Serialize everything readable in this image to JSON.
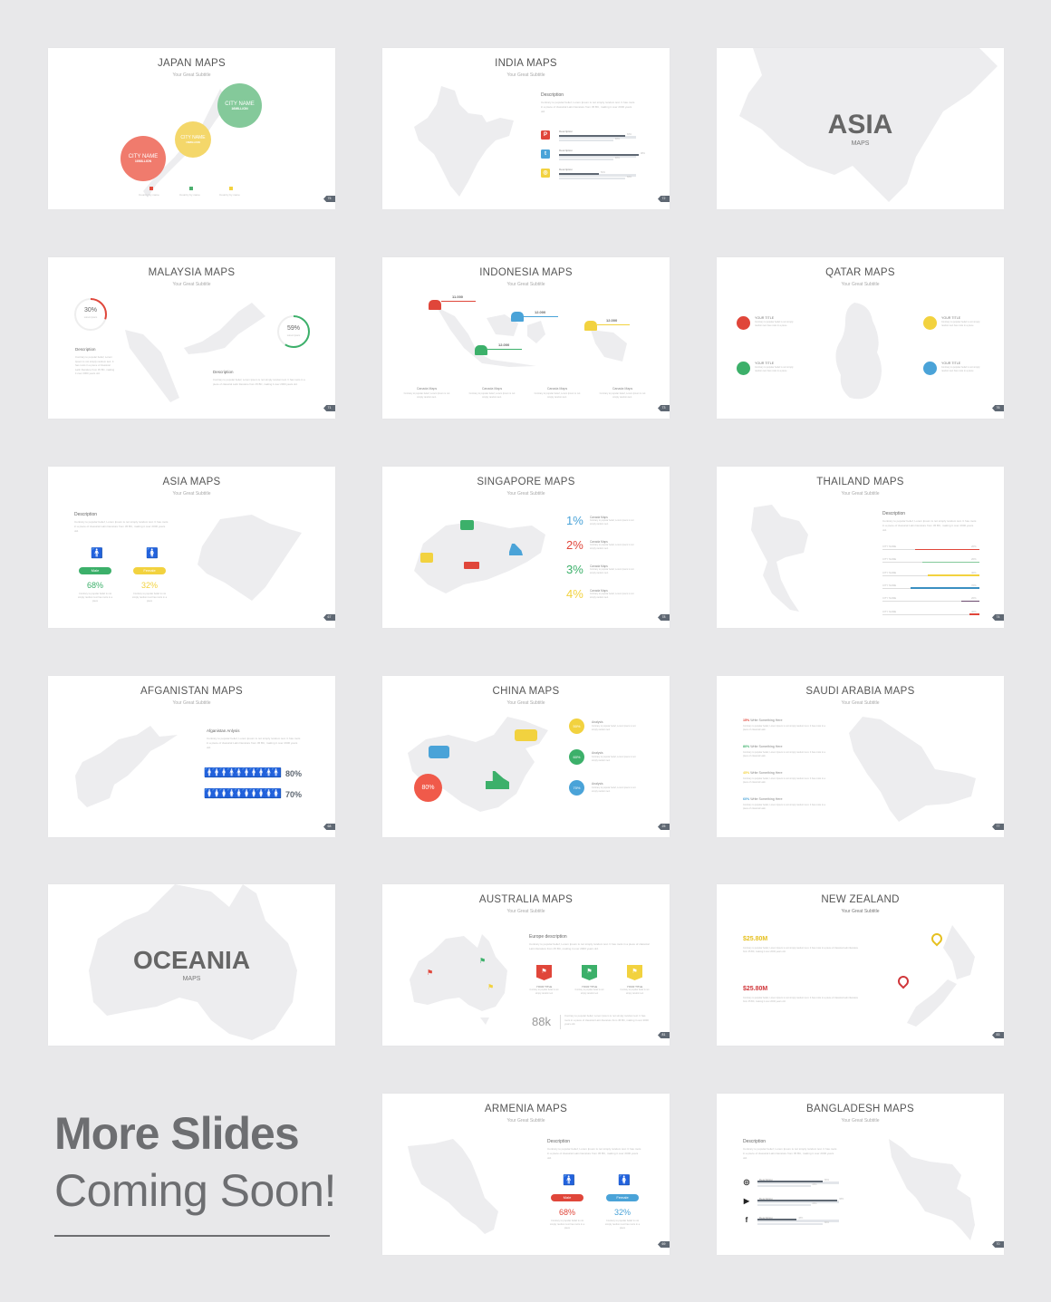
{
  "slides": {
    "japan": {
      "title": "JAPAN MAPS",
      "subtitle": "Your Great Subtitle",
      "page": "75",
      "cities": [
        {
          "name": "CITY NAME",
          "value": "16MILLION",
          "color": "#f07b6d"
        },
        {
          "name": "CITY NAME",
          "value": "16MILLION",
          "color": "#f4d76a"
        },
        {
          "name": "CITY NAME",
          "value": "16MILLION",
          "color": "#84c99a"
        }
      ],
      "legend": [
        {
          "label": "Country by name",
          "color": "#e24a3b"
        },
        {
          "label": "Country by name",
          "color": "#4caf6e"
        },
        {
          "label": "Country by name",
          "color": "#f2d23f"
        }
      ]
    },
    "india": {
      "title": "INDIA MAPS",
      "subtitle": "Your Great Subtitle",
      "page": "72",
      "desc_heading": "Description",
      "desc_text": "Contrary to popular belief, Lorem Ipsum is not simply random text. It has roots in a piece of classical Latin literature from 45 BC, making it over 2000 years old.",
      "stats": [
        {
          "icon": "pinterest-icon",
          "glyph": "P",
          "color": "#e0463a",
          "label": "Description",
          "primary": 0.83,
          "secondary": 0.68,
          "primary_label": "83%",
          "secondary_label": "68%"
        },
        {
          "icon": "twitter-icon",
          "glyph": "t",
          "color": "#4aa3d8",
          "label": "Description",
          "primary": 1.0,
          "secondary": 0.68,
          "primary_label": "98%",
          "secondary_label": "68%"
        },
        {
          "icon": "instagram-icon",
          "glyph": "◎",
          "color": "#f2d23f",
          "label": "Description",
          "primary": 0.5,
          "secondary": 0.83,
          "primary_label": "50%",
          "secondary_label": "83%"
        }
      ]
    },
    "asia_cover": {
      "title": "ASIA",
      "subtitle": "MAPS"
    },
    "malaysia": {
      "title": "MALAYSIA MAPS",
      "subtitle": "Your Great Subtitle",
      "page": "71",
      "ring1": {
        "value": "30%",
        "fraction": 0.3,
        "caption": "Lorem ipsum",
        "color": "#e0463a"
      },
      "ring2": {
        "value": "59%",
        "fraction": 0.59,
        "caption": "Lorem ipsum",
        "color": "#3cb06a"
      },
      "desc1_heading": "Description",
      "desc1_text": "Contrary to popular belief, Lorem Ipsum is not simply random text. It has roots in a piece of classical Latin literature from 45 BC, making it over 2000 years old.",
      "desc2_heading": "Description",
      "desc2_text": "Contrary to popular belief, Lorem Ipsum is not simply random text. It has roots in a piece of classical Latin literature from 45 BC, making it over 2000 years old."
    },
    "indonesia": {
      "title": "INDONESIA MAPS",
      "subtitle": "Your Great Subtitle",
      "page": "73",
      "markers": [
        {
          "value": "11.000",
          "color": "#e0463a"
        },
        {
          "value": "12.000",
          "color": "#4aa3d8"
        },
        {
          "value": "12.000",
          "color": "#f2d23f"
        },
        {
          "value": "12.000",
          "color": "#3cb06a"
        }
      ],
      "columns": [
        {
          "heading": "Canada Maps",
          "text": "Contrary to popular belief, Lorem Ipsum is not simply random text."
        },
        {
          "heading": "Canada Maps",
          "text": "Contrary to popular belief, Lorem Ipsum is not simply random text."
        },
        {
          "heading": "Canada Maps",
          "text": "Contrary to popular belief, Lorem Ipsum is not simply random text."
        },
        {
          "heading": "Canada Maps",
          "text": "Contrary to popular belief, Lorem Ipsum is not simply random text."
        }
      ]
    },
    "qatar": {
      "title": "QATAR MAPS",
      "subtitle": "Your Great Subtitle",
      "page": "76",
      "items": [
        {
          "title": "YOUR TITLE",
          "text": "Contrary to popular belief is not simply random text has roots in a piece",
          "color": "#e0463a"
        },
        {
          "title": "YOUR TITLE",
          "text": "Contrary to popular belief is not simply random text has roots in a piece",
          "color": "#3cb06a"
        },
        {
          "title": "YOUR TITLE",
          "text": "Contrary to popular belief is not simply random text has roots in a piece",
          "color": "#f2d23f"
        },
        {
          "title": "YOUR TITLE",
          "text": "Contrary to popular belief is not simply random text has roots in a piece",
          "color": "#4aa3d8"
        }
      ]
    },
    "asia": {
      "title": "ASIA MAPS",
      "subtitle": "Your Great Subtitle",
      "page": "67",
      "desc_heading": "Description",
      "desc_text": "Contrary to popular belief, Lorem Ipsum is not simply random text. It has roots in a piece of classical Latin literature from 45 BC, making it over 2000 years old.",
      "male": {
        "label": "Male",
        "value": "68%",
        "color": "#3cb06a",
        "text": "Contrary to popular belief is not simply random text has roots in a piece"
      },
      "female": {
        "label": "Female",
        "value": "32%",
        "color": "#f2d23f",
        "text": "Contrary to popular belief is not simply random text has roots in a piece"
      }
    },
    "singapore": {
      "title": "SINGAPORE MAPS",
      "subtitle": "Your Great Subtitle",
      "page": "78",
      "stats": [
        {
          "value": "1%",
          "color": "#4aa3d8",
          "heading": "Canada Maps",
          "text": "Contrary to popular belief, Lorem Ipsum is not simply random text."
        },
        {
          "value": "2%",
          "color": "#e0463a",
          "heading": "Canada Maps",
          "text": "Contrary to popular belief, Lorem Ipsum is not simply random text."
        },
        {
          "value": "3%",
          "color": "#3cb06a",
          "heading": "Canada Maps",
          "text": "Contrary to popular belief, Lorem Ipsum is not simply random text."
        },
        {
          "value": "4%",
          "color": "#f2d23f",
          "heading": "Canada Maps",
          "text": "Contrary to popular belief, Lorem Ipsum is not simply random text."
        }
      ]
    },
    "thailand": {
      "title": "THAILAND MAPS",
      "subtitle": "Your Great Subtitle",
      "page": "74",
      "desc_heading": "Description",
      "desc_text": "Contrary to popular belief, Lorem Ipsum is not simply random text. It has roots in a piece of classical Latin literature from 45 BC, making it over 2000 years old.",
      "bars": [
        {
          "label": "CITY NAME",
          "value": "20%",
          "fraction": 0.66,
          "color": "#e0463a"
        },
        {
          "label": "CITY NAME",
          "value": "20%",
          "fraction": 0.59,
          "color": "#84c99a"
        },
        {
          "label": "CITY NAME",
          "value": "40%",
          "fraction": 0.53,
          "color": "#f2d23f"
        },
        {
          "label": "CITY NAME",
          "value": "70%",
          "fraction": 0.71,
          "color": "#3a8fc1"
        },
        {
          "label": "CITY NAME",
          "value": "20%",
          "fraction": 0.19,
          "color": "#6b4a6e"
        },
        {
          "label": "CITY NAME",
          "value": "40%",
          "fraction": 0.1,
          "color": "#e0463a"
        }
      ]
    },
    "afganistan": {
      "title": "AFGANISTAN MAPS",
      "subtitle": "Your Great Subtitle",
      "page": "68",
      "heading": "Afganistan Anlysis",
      "text": "Contrary to popular belief, Lorem Ipsum is not simply random text. It has roots in a piece of classical Latin literature from 45 BC, making it over 2000 years old.",
      "rows": [
        {
          "value": "80%",
          "filled": 8,
          "total": 10
        },
        {
          "value": "70%",
          "filled": 7,
          "total": 10
        }
      ]
    },
    "china": {
      "title": "CHINA MAPS",
      "subtitle": "Your Great Subtitle",
      "page": "25",
      "big_stat": {
        "value": "80%",
        "color": "#f05a4a"
      },
      "items": [
        {
          "value": "50%",
          "color": "#f2d23f",
          "heading": "Analysis",
          "text": "Contrary to popular belief, Lorem Ipsum is not simply random text."
        },
        {
          "value": "60%",
          "color": "#3cb06a",
          "heading": "Analysis",
          "text": "Contrary to popular belief, Lorem Ipsum is not simply random text."
        },
        {
          "value": "70%",
          "color": "#4aa3d8",
          "heading": "Analysis",
          "text": "Contrary to popular belief, Lorem Ipsum is not simply random text."
        }
      ]
    },
    "saudi": {
      "title": "SAUDI ARABIA MAPS",
      "subtitle": "Your Great Subtitle",
      "page": "77",
      "items": [
        {
          "value": "15%",
          "color": "#e0463a",
          "label": "Write Something Here",
          "text": "Contrary to popular belief, Lorem Ipsum is not simply random text. It has roots in a piece of classical Latin."
        },
        {
          "value": "80%",
          "color": "#3cb06a",
          "label": "Write Something Here",
          "text": "Contrary to popular belief, Lorem Ipsum is not simply random text. It has roots in a piece of classical Latin."
        },
        {
          "value": "45%",
          "color": "#f2d23f",
          "label": "Write Something Here",
          "text": "Contrary to popular belief, Lorem Ipsum is not simply random text. It has roots in a piece of classical Latin."
        },
        {
          "value": "60%",
          "color": "#4aa3d8",
          "label": "Write Something Here",
          "text": "Contrary to popular belief, Lorem Ipsum is not simply random text. It has roots in a piece of classical Latin."
        }
      ]
    },
    "oceania_cover": {
      "title": "OCEANIA",
      "subtitle": "MAPS"
    },
    "australia": {
      "title": "AUSTRALIA MAPS",
      "subtitle": "Your Great Subtitle",
      "page": "81",
      "desc_heading": "Europe description",
      "desc_text": "Contrary to popular belief, Lorem Ipsum is not simply random text. It has roots in a piece of classical Latin literature from 45 BC, making it over 2000 years old.",
      "flags": [
        {
          "title": "YOUR TITLE",
          "text": "Contrary to popular belief is not simply random text",
          "color": "#e0463a"
        },
        {
          "title": "YOUR TITLE",
          "text": "Contrary to popular belief is not simply random text",
          "color": "#3cb06a"
        },
        {
          "title": "YOUR TITLE",
          "text": "Contrary to popular belief is not simply random text",
          "color": "#f2d23f"
        }
      ],
      "big_value": "88k",
      "big_text": "Contrary to popular belief, Lorem Ipsum is not simply random text. It has roots in a piece of classical Latin literature from 45 BC, making it over 2000 years old."
    },
    "new_zealand": {
      "title": "NEW ZEALAND",
      "subtitle": "Your Great Subtitle",
      "page": "83",
      "items": [
        {
          "value": "$25.80M",
          "color": "#e6c020",
          "text": "Contrary to popular belief, Lorem Ipsum is not simply random text. It has roots in a piece of classical Latin literature from 45 BC, making it over 2000 years old."
        },
        {
          "value": "$25.80M",
          "color": "#d0363a",
          "text": "Contrary to popular belief, Lorem Ipsum is not simply random text. It has roots in a piece of classical Latin literature from 45 BC, making it over 2000 years old."
        }
      ]
    },
    "armenia": {
      "title": "ARMENIA MAPS",
      "subtitle": "Your Great Subtitle",
      "page": "69",
      "desc_heading": "Description",
      "desc_text": "Contrary to popular belief, Lorem Ipsum is not simply random text. It has roots in a piece of classical Latin literature from 45 BC, making it over 2000 years old.",
      "male": {
        "label": "Male",
        "value": "68%",
        "color": "#e0463a",
        "text": "Contrary to popular belief is not simply random text has roots in a piece"
      },
      "female": {
        "label": "Female",
        "value": "32%",
        "color": "#4aa3d8",
        "text": "Contrary to popular belief is not simply random text has roots in a piece"
      }
    },
    "bangladesh": {
      "title": "BANGLADESH MAPS",
      "subtitle": "Your Great Subtitle",
      "page": "70",
      "desc_heading": "Description",
      "desc_text": "Contrary to popular belief, Lorem Ipsum is not simply random text. It has roots in a piece of classical Latin literature from 45 BC, making it over 2000 years old.",
      "stats": [
        {
          "icon": "instagram-icon",
          "glyph": "◎",
          "label": "Description",
          "primary": 0.8,
          "secondary": 0.65,
          "primary_label": "80%",
          "secondary_label": "65%"
        },
        {
          "icon": "youtube-icon",
          "glyph": "▶",
          "label": "Description",
          "primary": 0.98,
          "secondary": 0.65,
          "primary_label": "98%",
          "secondary_label": "65%"
        },
        {
          "icon": "facebook-icon",
          "glyph": "f",
          "label": "Description",
          "primary": 0.48,
          "secondary": 0.8,
          "primary_label": "48%",
          "secondary_label": "80%"
        }
      ]
    }
  },
  "promo": {
    "title": "More Slides",
    "subtitle": "Coming Soon!"
  },
  "colors": {
    "background": "#e8e8ea",
    "slide": "#ffffff",
    "map": "#ededef",
    "text_dark": "#6d6e71",
    "badge": "#5f6873"
  }
}
